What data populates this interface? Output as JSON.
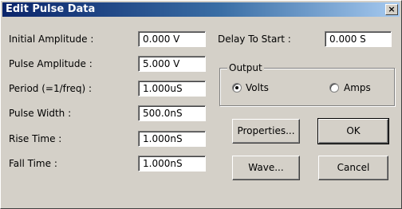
{
  "window": {
    "title": "Edit Pulse Data",
    "close_glyph": "×"
  },
  "fields": [
    {
      "label": "Initial Amplitude :",
      "value": "0.000 V"
    },
    {
      "label": "Pulse Amplitude :",
      "value": "5.000 V"
    },
    {
      "label": "Period (=1/freq) :",
      "value": "1.000uS"
    },
    {
      "label": "Pulse Width :",
      "value": "500.0nS"
    },
    {
      "label": "Rise Time :",
      "value": "1.000nS"
    },
    {
      "label": "Fall Time :",
      "value": "1.000nS"
    }
  ],
  "delay": {
    "label": "Delay To Start :",
    "value": "0.000 S"
  },
  "output": {
    "group_label": "Output",
    "options": [
      {
        "label": "Volts",
        "selected": true
      },
      {
        "label": "Amps",
        "selected": false
      }
    ]
  },
  "buttons": {
    "properties": "Properties...",
    "ok": "OK",
    "wave": "Wave...",
    "cancel": "Cancel"
  }
}
